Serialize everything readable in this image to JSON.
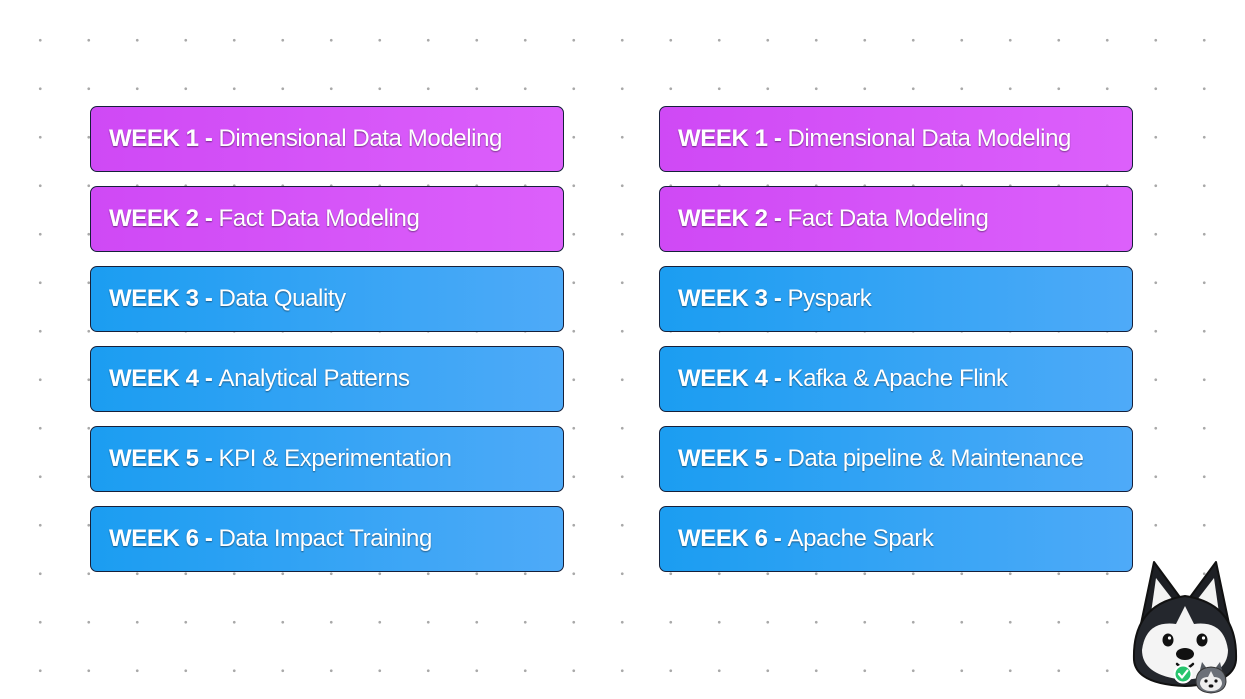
{
  "columns": [
    {
      "weeks": [
        {
          "label": "WEEK 1 -",
          "topic": "Dimensional Data Modeling",
          "color": "#d356f8"
        },
        {
          "label": "WEEK 2 -",
          "topic": "Fact Data Modeling",
          "color": "#d356f8"
        },
        {
          "label": "WEEK 3 -",
          "topic": "Data Quality",
          "color": "#2ea3f5"
        },
        {
          "label": "WEEK 4 -",
          "topic": "Analytical Patterns",
          "color": "#2ea3f5"
        },
        {
          "label": "WEEK 5 -",
          "topic": "KPI & Experimentation",
          "color": "#2ea3f5"
        },
        {
          "label": "WEEK 6 -",
          "topic": "Data Impact Training",
          "color": "#2ea3f5"
        }
      ]
    },
    {
      "weeks": [
        {
          "label": "WEEK 1 -",
          "topic": "Dimensional Data Modeling",
          "color": "#d356f8"
        },
        {
          "label": "WEEK 2 -",
          "topic": "Fact Data Modeling",
          "color": "#d356f8"
        },
        {
          "label": "WEEK 3 -",
          "topic": "Pyspark",
          "color": "#2ea3f5"
        },
        {
          "label": "WEEK 4 -",
          "topic": "Kafka & Apache Flink",
          "color": "#2ea3f5"
        },
        {
          "label": "WEEK 5 -",
          "topic": "Data pipeline & Maintenance",
          "color": "#2ea3f5"
        },
        {
          "label": "WEEK 6 -",
          "topic": "Apache Spark",
          "color": "#2ea3f5"
        }
      ]
    }
  ],
  "mascot": {
    "icon": "husky-mascot-icon",
    "badge_icon": "check-badge-icon"
  }
}
